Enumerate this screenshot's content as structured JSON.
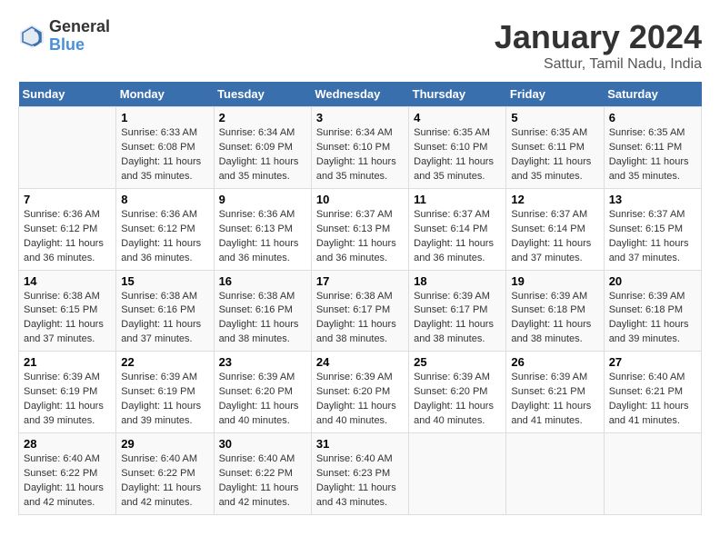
{
  "header": {
    "logo_line1": "General",
    "logo_line2": "Blue",
    "main_title": "January 2024",
    "subtitle": "Sattur, Tamil Nadu, India"
  },
  "calendar": {
    "days_of_week": [
      "Sunday",
      "Monday",
      "Tuesday",
      "Wednesday",
      "Thursday",
      "Friday",
      "Saturday"
    ],
    "weeks": [
      [
        {
          "day": "",
          "info": ""
        },
        {
          "day": "1",
          "info": "Sunrise: 6:33 AM\nSunset: 6:08 PM\nDaylight: 11 hours\nand 35 minutes."
        },
        {
          "day": "2",
          "info": "Sunrise: 6:34 AM\nSunset: 6:09 PM\nDaylight: 11 hours\nand 35 minutes."
        },
        {
          "day": "3",
          "info": "Sunrise: 6:34 AM\nSunset: 6:10 PM\nDaylight: 11 hours\nand 35 minutes."
        },
        {
          "day": "4",
          "info": "Sunrise: 6:35 AM\nSunset: 6:10 PM\nDaylight: 11 hours\nand 35 minutes."
        },
        {
          "day": "5",
          "info": "Sunrise: 6:35 AM\nSunset: 6:11 PM\nDaylight: 11 hours\nand 35 minutes."
        },
        {
          "day": "6",
          "info": "Sunrise: 6:35 AM\nSunset: 6:11 PM\nDaylight: 11 hours\nand 35 minutes."
        }
      ],
      [
        {
          "day": "7",
          "info": "Sunrise: 6:36 AM\nSunset: 6:12 PM\nDaylight: 11 hours\nand 36 minutes."
        },
        {
          "day": "8",
          "info": "Sunrise: 6:36 AM\nSunset: 6:12 PM\nDaylight: 11 hours\nand 36 minutes."
        },
        {
          "day": "9",
          "info": "Sunrise: 6:36 AM\nSunset: 6:13 PM\nDaylight: 11 hours\nand 36 minutes."
        },
        {
          "day": "10",
          "info": "Sunrise: 6:37 AM\nSunset: 6:13 PM\nDaylight: 11 hours\nand 36 minutes."
        },
        {
          "day": "11",
          "info": "Sunrise: 6:37 AM\nSunset: 6:14 PM\nDaylight: 11 hours\nand 36 minutes."
        },
        {
          "day": "12",
          "info": "Sunrise: 6:37 AM\nSunset: 6:14 PM\nDaylight: 11 hours\nand 37 minutes."
        },
        {
          "day": "13",
          "info": "Sunrise: 6:37 AM\nSunset: 6:15 PM\nDaylight: 11 hours\nand 37 minutes."
        }
      ],
      [
        {
          "day": "14",
          "info": "Sunrise: 6:38 AM\nSunset: 6:15 PM\nDaylight: 11 hours\nand 37 minutes."
        },
        {
          "day": "15",
          "info": "Sunrise: 6:38 AM\nSunset: 6:16 PM\nDaylight: 11 hours\nand 37 minutes."
        },
        {
          "day": "16",
          "info": "Sunrise: 6:38 AM\nSunset: 6:16 PM\nDaylight: 11 hours\nand 38 minutes."
        },
        {
          "day": "17",
          "info": "Sunrise: 6:38 AM\nSunset: 6:17 PM\nDaylight: 11 hours\nand 38 minutes."
        },
        {
          "day": "18",
          "info": "Sunrise: 6:39 AM\nSunset: 6:17 PM\nDaylight: 11 hours\nand 38 minutes."
        },
        {
          "day": "19",
          "info": "Sunrise: 6:39 AM\nSunset: 6:18 PM\nDaylight: 11 hours\nand 38 minutes."
        },
        {
          "day": "20",
          "info": "Sunrise: 6:39 AM\nSunset: 6:18 PM\nDaylight: 11 hours\nand 39 minutes."
        }
      ],
      [
        {
          "day": "21",
          "info": "Sunrise: 6:39 AM\nSunset: 6:19 PM\nDaylight: 11 hours\nand 39 minutes."
        },
        {
          "day": "22",
          "info": "Sunrise: 6:39 AM\nSunset: 6:19 PM\nDaylight: 11 hours\nand 39 minutes."
        },
        {
          "day": "23",
          "info": "Sunrise: 6:39 AM\nSunset: 6:20 PM\nDaylight: 11 hours\nand 40 minutes."
        },
        {
          "day": "24",
          "info": "Sunrise: 6:39 AM\nSunset: 6:20 PM\nDaylight: 11 hours\nand 40 minutes."
        },
        {
          "day": "25",
          "info": "Sunrise: 6:39 AM\nSunset: 6:20 PM\nDaylight: 11 hours\nand 40 minutes."
        },
        {
          "day": "26",
          "info": "Sunrise: 6:39 AM\nSunset: 6:21 PM\nDaylight: 11 hours\nand 41 minutes."
        },
        {
          "day": "27",
          "info": "Sunrise: 6:40 AM\nSunset: 6:21 PM\nDaylight: 11 hours\nand 41 minutes."
        }
      ],
      [
        {
          "day": "28",
          "info": "Sunrise: 6:40 AM\nSunset: 6:22 PM\nDaylight: 11 hours\nand 42 minutes."
        },
        {
          "day": "29",
          "info": "Sunrise: 6:40 AM\nSunset: 6:22 PM\nDaylight: 11 hours\nand 42 minutes."
        },
        {
          "day": "30",
          "info": "Sunrise: 6:40 AM\nSunset: 6:22 PM\nDaylight: 11 hours\nand 42 minutes."
        },
        {
          "day": "31",
          "info": "Sunrise: 6:40 AM\nSunset: 6:23 PM\nDaylight: 11 hours\nand 43 minutes."
        },
        {
          "day": "",
          "info": ""
        },
        {
          "day": "",
          "info": ""
        },
        {
          "day": "",
          "info": ""
        }
      ]
    ]
  }
}
